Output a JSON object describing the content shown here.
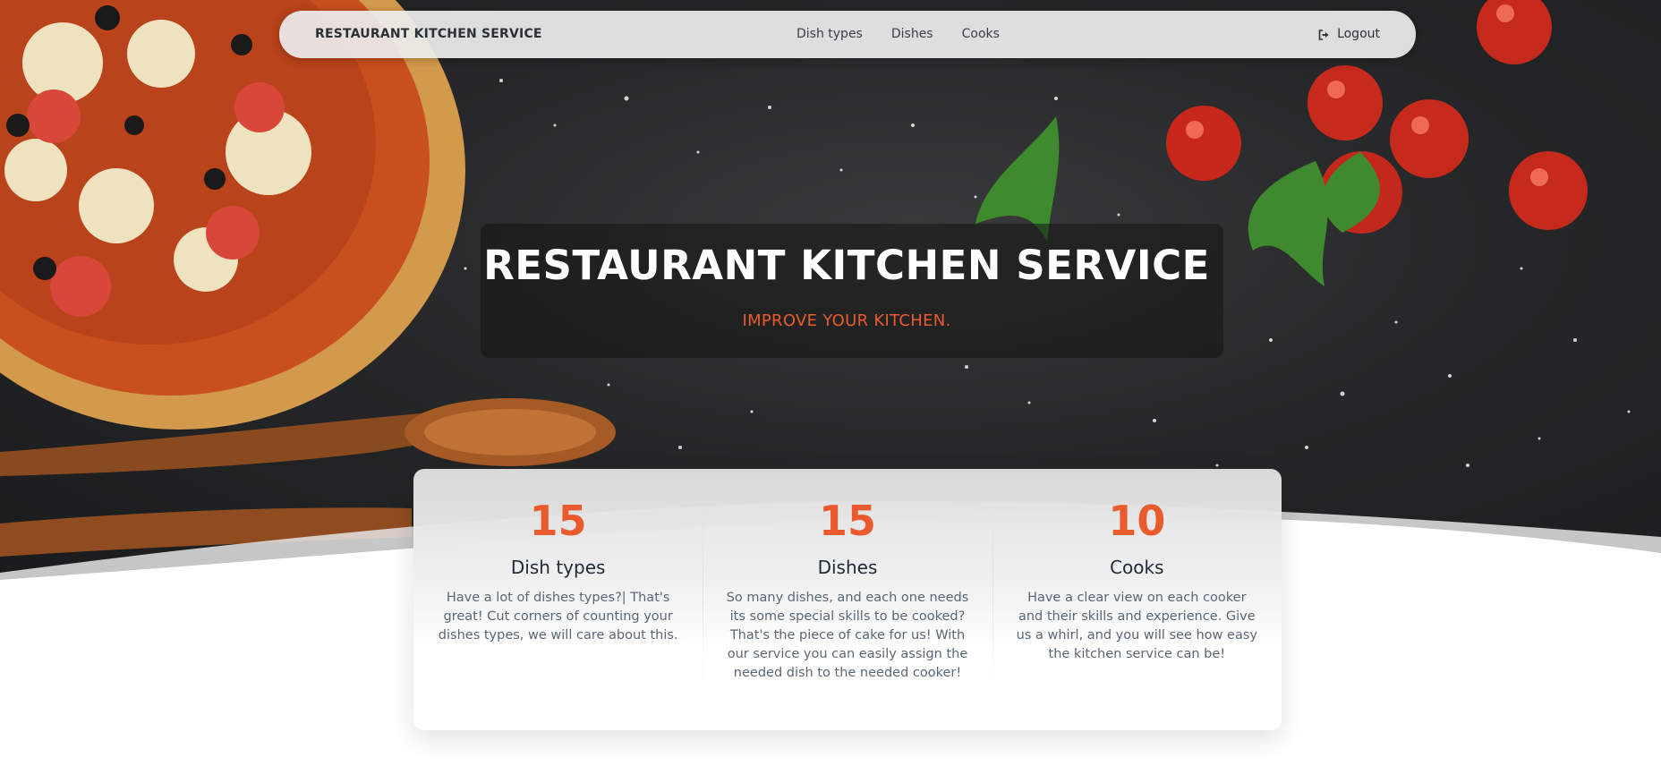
{
  "navbar": {
    "brand": "RESTAURANT KITCHEN SERVICE",
    "links": [
      "Dish types",
      "Dishes",
      "Cooks"
    ],
    "logout_label": "Logout",
    "logout_icon": "sign-out-icon"
  },
  "hero": {
    "title": "RESTAURANT KITCHEN SERVICE",
    "subtitle": "IMPROVE YOUR KITCHEN."
  },
  "stats": [
    {
      "number": "15",
      "title": "Dish types",
      "description": "Have a lot of dishes types?| That's great! Cut corners of counting your dishes types, we will care about this."
    },
    {
      "number": "15",
      "title": "Dishes",
      "description": "So many dishes, and each one needs its some special skills to be cooked? That's the piece of cake for us! With our service you can easily assign the needed dish to the needed cooker!"
    },
    {
      "number": "10",
      "title": "Cooks",
      "description": "Have a clear view on each cooker and their skills and experience. Give us a whirl, and you will see how easy the kitchen service can be!"
    }
  ],
  "colors": {
    "accent": "#e95b2c",
    "navbar_bg": "#ececec",
    "hero_dark": "#262728"
  }
}
